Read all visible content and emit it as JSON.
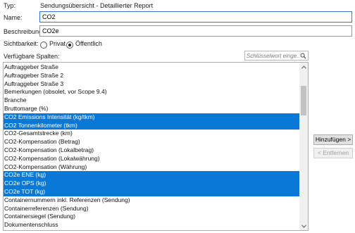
{
  "form": {
    "type_label": "Typ:",
    "type_value": "Sendungsübersicht - Detaillierter Report",
    "name_label": "Name:",
    "name_value": "CO2",
    "description_label": "Beschreibung:",
    "description_value": "CO2e",
    "visibility_label": "Sichtbarkeit:",
    "visibility_options": [
      {
        "label": "Privat",
        "checked": false
      },
      {
        "label": "Öffentlich",
        "checked": true
      }
    ]
  },
  "columns": {
    "label": "Verfügbare Spalten:",
    "search_placeholder": "Schlüsselwort einge...",
    "items": [
      {
        "label": "Auftraggeber Straße",
        "selected": false
      },
      {
        "label": "Auftraggeber Straße 2",
        "selected": false
      },
      {
        "label": "Auftraggeber Straße 3",
        "selected": false
      },
      {
        "label": "Bemerkungen (obsolet, vor Scope 9.4)",
        "selected": false
      },
      {
        "label": "Branche",
        "selected": false
      },
      {
        "label": "Bruttomarge (%)",
        "selected": false
      },
      {
        "label": "CO2 Emissions Intensität (kg/tkm)",
        "selected": true
      },
      {
        "label": "CO2 Tonnenkilometer (tkm)",
        "selected": true
      },
      {
        "label": "CO2-Gesamtstrecke (km)",
        "selected": false
      },
      {
        "label": "CO2-Kompensation (Betrag)",
        "selected": false
      },
      {
        "label": "CO2-Kompensation (Lokalbetrag)",
        "selected": false
      },
      {
        "label": "CO2-Kompensation (Lokalwährung)",
        "selected": false
      },
      {
        "label": "CO2-Kompensation (Währung)",
        "selected": false
      },
      {
        "label": "CO2e ENE (kg)",
        "selected": true
      },
      {
        "label": "CO2e OPS (kg)",
        "selected": true
      },
      {
        "label": "CO2e TOT (kg)",
        "selected": true
      },
      {
        "label": "Containernummern inkl. Referenzen (Sendung)",
        "selected": false
      },
      {
        "label": "Containerreferenzen (Sendung)",
        "selected": false
      },
      {
        "label": "Containersiegel (Sendung)",
        "selected": false
      },
      {
        "label": "Dokumentenschluss",
        "selected": false
      }
    ]
  },
  "buttons": {
    "add_label": "Hinzufügen >",
    "remove_label": "< Entfernen"
  },
  "colors": {
    "selection": "#0a78d7",
    "focus_border": "#3b6fd8"
  },
  "icons": {
    "search": "search-icon",
    "scroll_up": "chevron-up-icon",
    "scroll_down": "chevron-down-icon"
  }
}
